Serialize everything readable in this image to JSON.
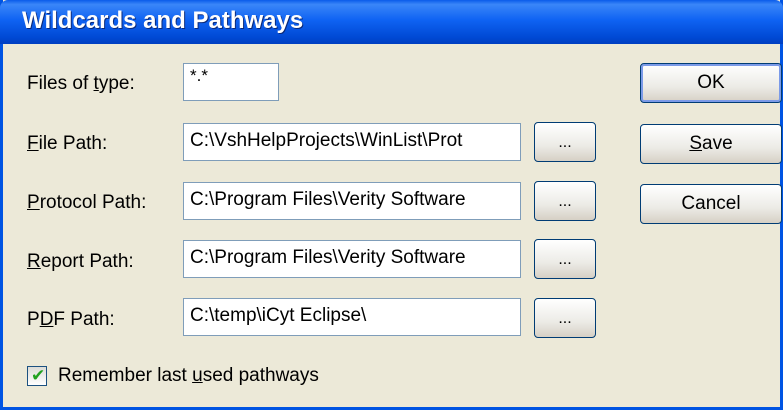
{
  "window": {
    "title": "Wildcards and Pathways"
  },
  "fields": {
    "files_of_type": {
      "label_pre": "Files of ",
      "label_u": "t",
      "label_post": "ype:",
      "value": "*.*"
    },
    "file_path": {
      "label_pre": "",
      "label_u": "F",
      "label_post": "ile Path:",
      "value": "C:\\VshHelpProjects\\WinList\\Prot"
    },
    "protocol_path": {
      "label_pre": "",
      "label_u": "P",
      "label_post": "rotocol Path:",
      "value": "C:\\Program Files\\Verity Software"
    },
    "report_path": {
      "label_pre": "",
      "label_u": "R",
      "label_post": "eport Path:",
      "value": "C:\\Program Files\\Verity Software"
    },
    "pdf_path": {
      "label_pre": "P",
      "label_u": "D",
      "label_post": "F Path:",
      "value": "C:\\temp\\iCyt Eclipse\\"
    }
  },
  "browse_label": "...",
  "buttons": {
    "ok": "OK",
    "save_u": "S",
    "save_rest": "ave",
    "cancel": "Cancel"
  },
  "remember": {
    "checked": true,
    "pre": "Remember last ",
    "u": "u",
    "post": "sed pathways"
  }
}
